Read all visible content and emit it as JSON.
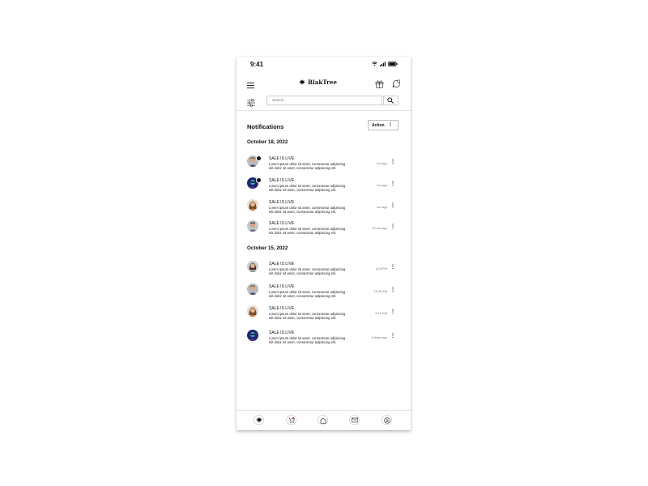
{
  "status": {
    "time": "9:41"
  },
  "brand": {
    "name": "BlakTree"
  },
  "search": {
    "placeholder": "Search..."
  },
  "page": {
    "title": "Notifications",
    "action_label": "Action"
  },
  "groups": [
    {
      "date": "October 18, 2022",
      "items": [
        {
          "title": "SALE IS LIVE",
          "body": "Lorem ipsum dolor sit amet, consectetur adipiscing elit dolor sit amet, consectetur adipiscing elit.",
          "time": "1m ago",
          "avatar": "man-1"
        },
        {
          "title": "SALE IS LIVE",
          "body": "Lorem ipsum dolor sit amet, consectetur adipiscing elit dolor sit amet, consectetur adipiscing elit.",
          "time": "1m ago",
          "avatar": "man-neon"
        },
        {
          "title": "SALE IS LIVE",
          "body": "Lorem ipsum dolor sit amet, consectetur adipiscing elit dolor sit amet, consectetur adipiscing elit.",
          "time": "1m ago",
          "avatar": "woman-1"
        },
        {
          "title": "SALE IS LIVE",
          "body": "Lorem ipsum dolor sit amet, consectetur adipiscing elit dolor sit amet, consectetur adipiscing elit.",
          "time": "10 hrs ago",
          "avatar": "man-2"
        }
      ]
    },
    {
      "date": "October 15, 2022",
      "items": [
        {
          "title": "SALE IS LIVE",
          "body": "Lorem ipsum dolor sit amet, consectetur adipiscing elit dolor sit amet, consectetur adipiscing elit.",
          "time": "6:02PM",
          "avatar": "woman-2"
        },
        {
          "title": "SALE IS LIVE",
          "body": "Lorem ipsum dolor sit amet, consectetur adipiscing elit dolor sit amet, consectetur adipiscing elit.",
          "time": "11:20 AM",
          "avatar": "man-1"
        },
        {
          "title": "SALE IS LIVE",
          "body": "Lorem ipsum dolor sit amet, consectetur adipiscing elit dolor sit amet, consectetur adipiscing elit.",
          "time": "6:10 AM",
          "avatar": "woman-1"
        },
        {
          "title": "SALE IS LIVE",
          "body": "Lorem ipsum dolor sit amet, consectetur adipiscing elit dolor sit amet, consectetur adipiscing elit.",
          "time": "3 days ago",
          "avatar": "man-neon"
        }
      ]
    }
  ],
  "nav": {
    "items": [
      "tree-icon",
      "cart-icon",
      "home-icon",
      "mail-icon",
      "profile-icon"
    ]
  },
  "colors": {
    "text": "#111111",
    "muted": "#777777",
    "border": "#cfcfcf"
  }
}
